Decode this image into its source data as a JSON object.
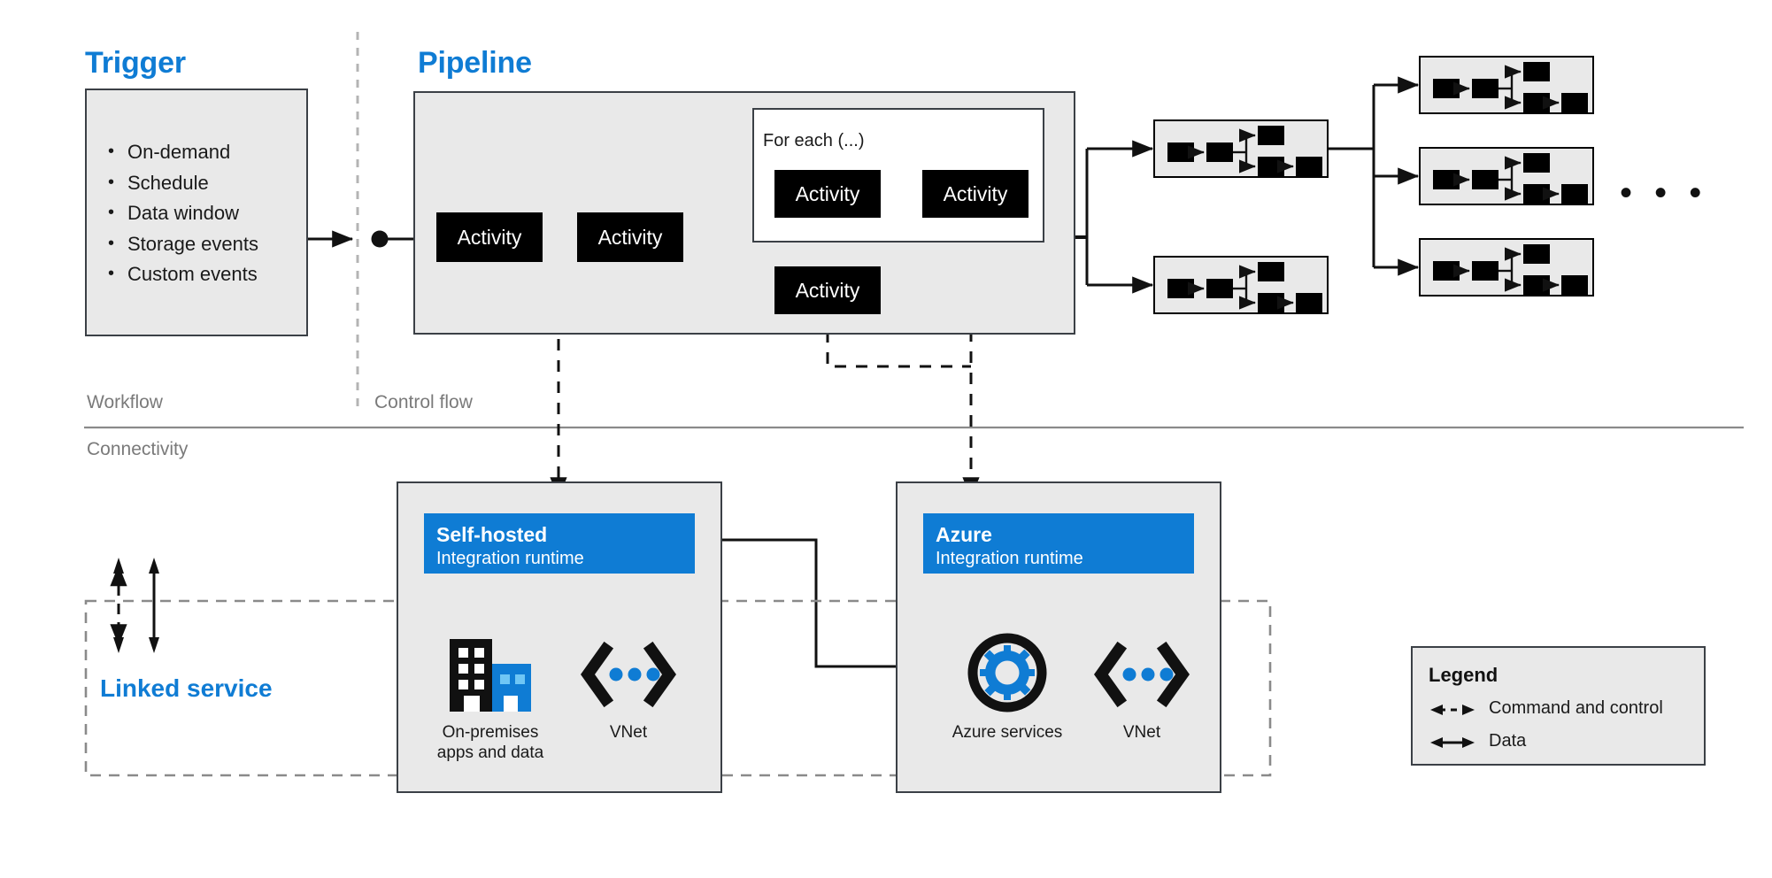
{
  "headings": {
    "trigger": "Trigger",
    "pipeline": "Pipeline",
    "linked_service": "Linked service"
  },
  "section_labels": {
    "workflow": "Workflow",
    "control_flow": "Control flow",
    "connectivity": "Connectivity"
  },
  "trigger": {
    "items": [
      "On-demand",
      "Schedule",
      "Data window",
      "Storage events",
      "Custom events"
    ]
  },
  "pipeline": {
    "activity_label": "Activity",
    "activities": [
      {
        "id": "a1",
        "label": "Activity"
      },
      {
        "id": "a2",
        "label": "Activity"
      },
      {
        "id": "a3",
        "label": "Activity"
      },
      {
        "id": "a4",
        "label": "Activity"
      },
      {
        "id": "a5",
        "label": "Activity"
      }
    ],
    "foreach": {
      "label": "For each (...)",
      "activities": [
        {
          "id": "fe1",
          "label": "Activity"
        },
        {
          "id": "fe2",
          "label": "Activity"
        }
      ]
    }
  },
  "thumbnails": {
    "count": 5,
    "ellipsis": "• • •"
  },
  "integration_runtimes": [
    {
      "id": "self-hosted",
      "title": "Self-hosted",
      "subtitle": "Integration runtime",
      "icons": [
        {
          "name": "on-premises-icon",
          "caption_line1": "On-premises",
          "caption_line2": "apps and data"
        },
        {
          "name": "vnet-icon",
          "caption_line1": "VNet",
          "caption_line2": ""
        }
      ]
    },
    {
      "id": "azure",
      "title": "Azure",
      "subtitle": "Integration runtime",
      "icons": [
        {
          "name": "azure-services-icon",
          "caption_line1": "Azure services",
          "caption_line2": ""
        },
        {
          "name": "vnet-icon",
          "caption_line1": "VNet",
          "caption_line2": ""
        }
      ]
    }
  ],
  "legend": {
    "title": "Legend",
    "items": [
      {
        "label": "Command and control",
        "style": "dashed-double-arrow"
      },
      {
        "label": "Data",
        "style": "solid-double-arrow"
      }
    ]
  },
  "colors": {
    "accent_blue": "#0f7cd4",
    "panel_grey": "#e9e9e9",
    "panel_border": "#3b4046",
    "activity_black": "#000000",
    "label_grey": "#7a7a7a",
    "divider_grey": "#9a9a9a"
  }
}
